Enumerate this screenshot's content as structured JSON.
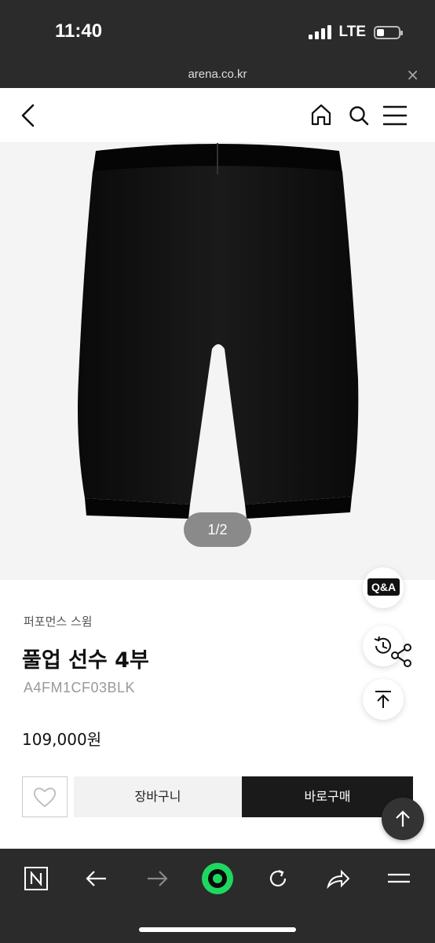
{
  "status_bar": {
    "time": "11:40",
    "network": "LTE"
  },
  "browser": {
    "url": "arena.co.kr",
    "close_icon": "close-icon"
  },
  "nav": {
    "icons": [
      "back-arrow-icon",
      "home-icon",
      "search-icon",
      "menu-icon"
    ]
  },
  "gallery": {
    "counter": "1/2"
  },
  "product": {
    "category": "퍼포먼스 스윔",
    "name": "풀업 선수 4부",
    "sku": "A4FM1CF03BLK",
    "price": "109,000원"
  },
  "floating": {
    "qa_label": "Q&A",
    "icons": [
      "qa-icon",
      "history-icon",
      "share-icon",
      "scroll-top-icon",
      "scroll-top-dark-icon"
    ]
  },
  "actions": {
    "cart_label": "장바구니",
    "buy_label": "바로구매",
    "wish_icon": "heart-icon"
  },
  "toolbar": {
    "icons": [
      "naver-n-icon",
      "back-icon",
      "forward-icon",
      "green-dot-icon",
      "reload-icon",
      "share-icon",
      "menu-icon"
    ]
  },
  "colors": {
    "dark_bar": "#2b2b2b",
    "buy_button": "#1a1a1a",
    "accent_green": "#1ed760"
  }
}
